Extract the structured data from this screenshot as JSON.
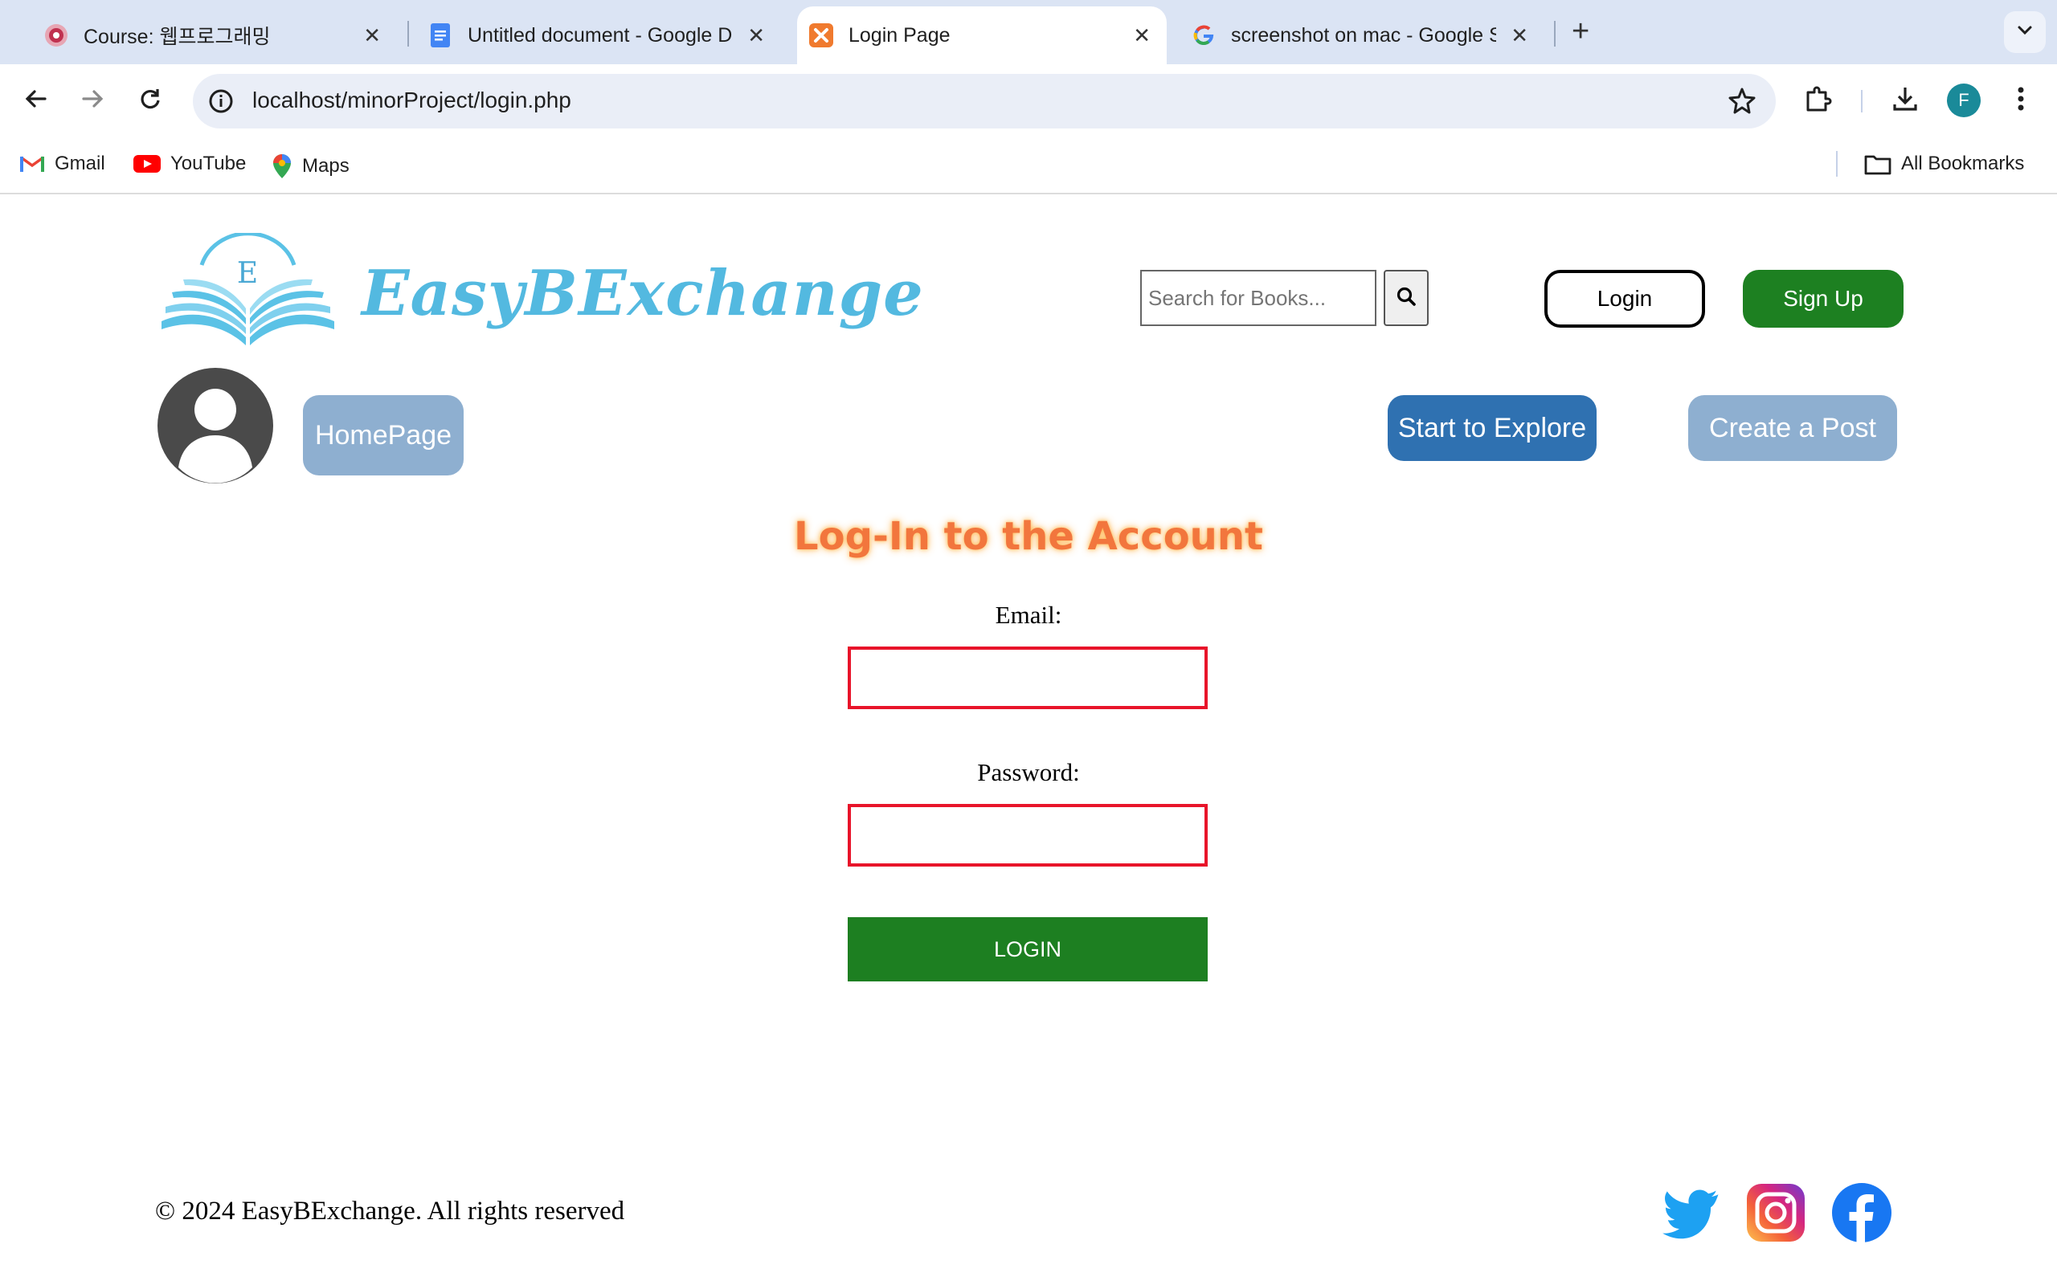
{
  "browser": {
    "tabs": [
      {
        "title": "Course: 웹프로그래밍",
        "icon": "course-icon",
        "active": false
      },
      {
        "title": "Untitled document - Google Docs",
        "icon": "google-docs-icon",
        "active": false
      },
      {
        "title": "Login Page",
        "icon": "xampp-icon",
        "active": true
      },
      {
        "title": "screenshot on mac - Google Search",
        "icon": "google-icon",
        "active": false
      }
    ],
    "new_tab_label": "+",
    "url": "localhost/minorProject/login.php",
    "profile_initial": "F",
    "bookmarks": [
      {
        "label": "Gmail",
        "icon": "gmail-icon"
      },
      {
        "label": "YouTube",
        "icon": "youtube-icon"
      },
      {
        "label": "Maps",
        "icon": "maps-icon"
      }
    ],
    "all_bookmarks_label": "All Bookmarks"
  },
  "header": {
    "brand": "EasyBExchange",
    "logo_letter": "E",
    "search_placeholder": "Search for Books...",
    "login_label": "Login",
    "signup_label": "Sign Up"
  },
  "nav": {
    "home_label": "HomePage",
    "explore_label": "Start to Explore",
    "create_post_label": "Create a Post"
  },
  "form": {
    "title": "Log-In to the Account",
    "email_label": "Email:",
    "email_value": "",
    "password_label": "Password:",
    "password_value": "",
    "submit_label": "LOGIN"
  },
  "footer": {
    "copyright": "© 2024 EasyBExchange. All rights reserved",
    "social": [
      "twitter-icon",
      "instagram-icon",
      "facebook-icon"
    ]
  },
  "colors": {
    "signup_green": "#1d8021",
    "explore_blue": "#2f71b1",
    "muted_blue": "#8eafd0",
    "title_orange": "#f2763d",
    "input_border_red": "#e8142a",
    "brand_cyan": "#53b9e0"
  }
}
